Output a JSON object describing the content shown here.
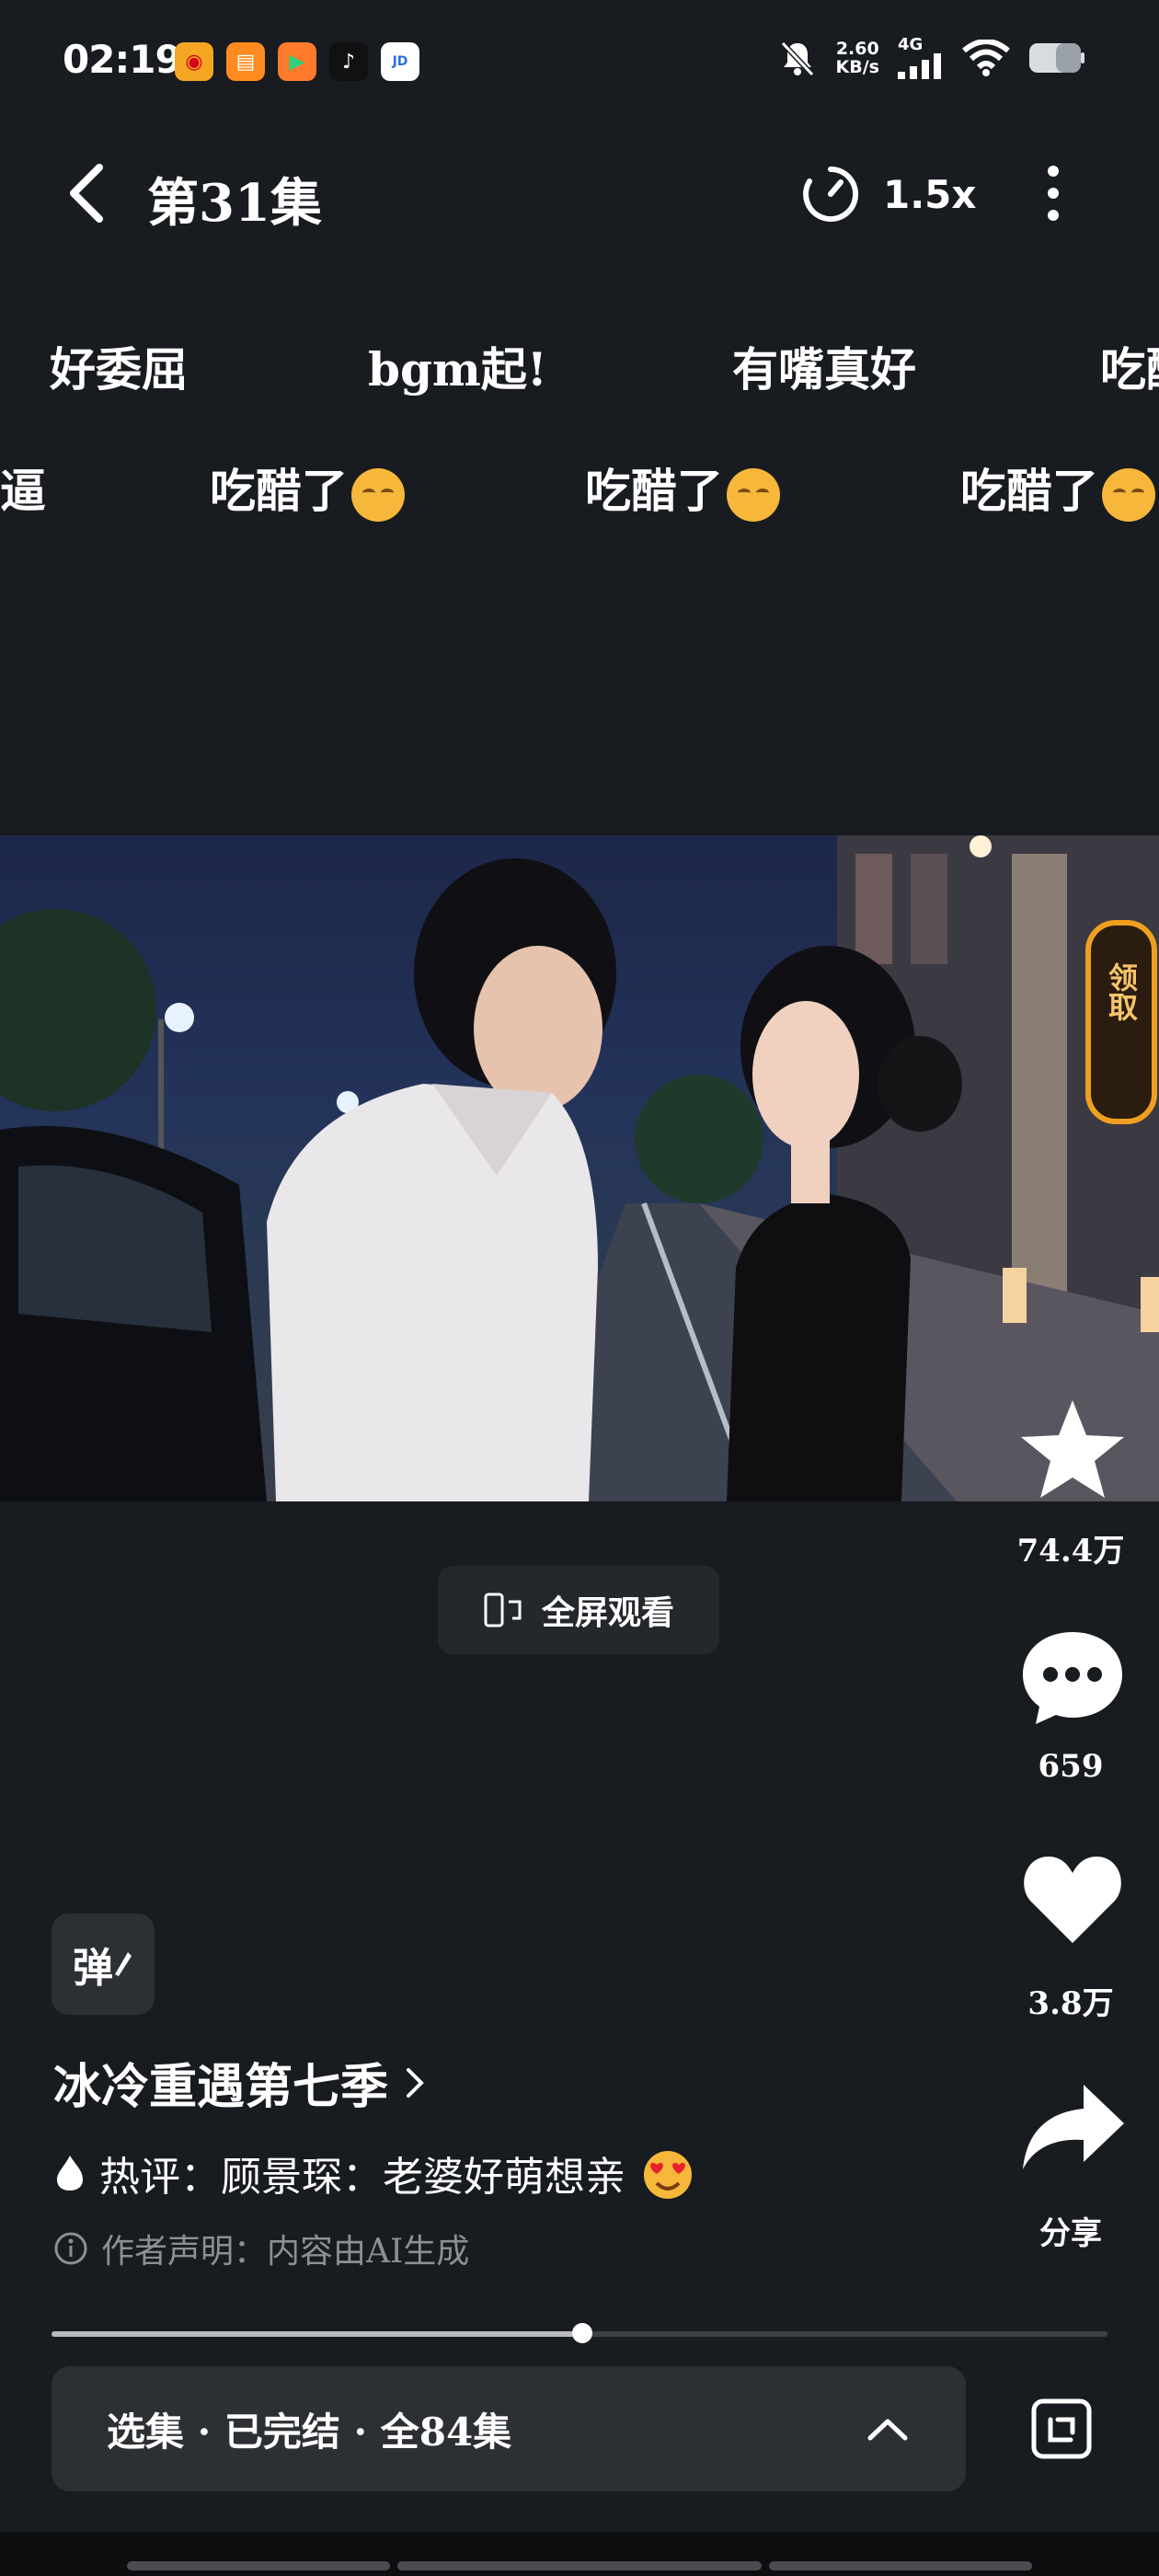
{
  "status_bar": {
    "time": "02:19",
    "net_speed_value": "2.60",
    "net_speed_unit": "KB/s",
    "network": "4G",
    "app_icons": [
      "weibo-icon",
      "orange-app-icon",
      "video-app-icon",
      "tiktok-icon",
      "jd-app-icon"
    ]
  },
  "header": {
    "title": "第31集",
    "speed": "1.5x"
  },
  "danmaku": {
    "row1": [
      "好委屈",
      "bgm起!",
      "有嘴真好",
      "吃醋"
    ],
    "row2": [
      "逼",
      "吃醋了",
      "吃醋了",
      "吃醋了"
    ]
  },
  "claim_badge": "领取",
  "actions": {
    "favorite_count": "74.4万",
    "comment_count": "659",
    "like_count": "3.8万",
    "share_label": "分享"
  },
  "fullscreen_label": "全屏观看",
  "danmaku_toggle": "弹",
  "drama_title": "冰冷重遇第七季",
  "hot_comment": "热评：顾景琛：老婆好萌想亲",
  "disclaimer": "作者声明：内容由AI生成",
  "progress": 0.503,
  "episodes_label": "选集 · 已完结 · 全84集",
  "colors": {
    "background": "#181b1f",
    "claim_border": "#f0a020"
  }
}
